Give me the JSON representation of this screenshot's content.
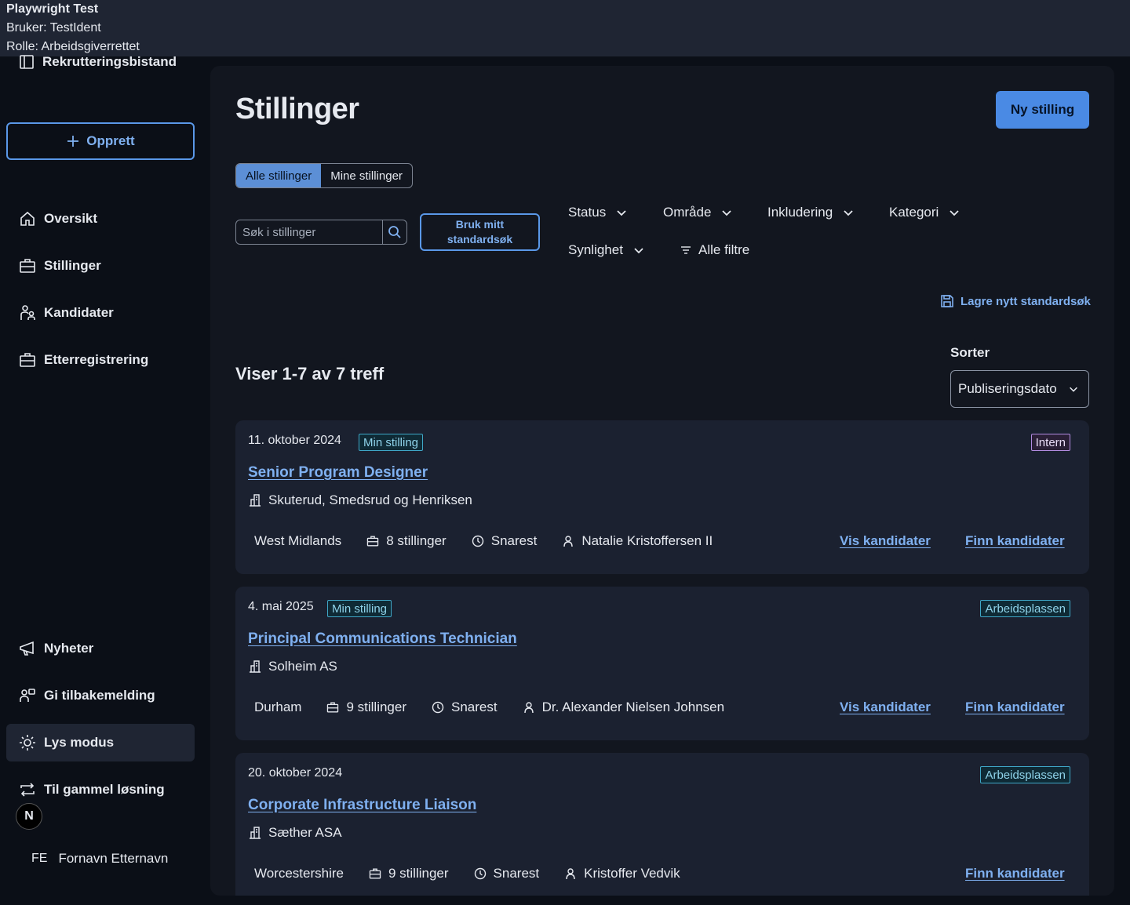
{
  "topbar": {
    "title": "Playwright Test",
    "user": "Bruker: TestIdent",
    "role": "Rolle: Arbeidsgiverrettet"
  },
  "sidebar": {
    "brand": "Rekrutteringsbistand",
    "create_label": "Opprett",
    "nav": [
      {
        "label": "Oversikt",
        "icon": "home-icon"
      },
      {
        "label": "Stillinger",
        "icon": "briefcase-icon"
      },
      {
        "label": "Kandidater",
        "icon": "people-icon"
      },
      {
        "label": "Etterregistrering",
        "icon": "briefcase-icon"
      }
    ],
    "bottom": [
      {
        "label": "Nyheter",
        "icon": "megaphone-icon"
      },
      {
        "label": "Gi tilbakemelding",
        "icon": "feedback-icon"
      },
      {
        "label": "Lys modus",
        "icon": "sun-icon"
      },
      {
        "label": "Til gammel løsning",
        "icon": "arrows-icon"
      }
    ],
    "badge": "N",
    "user_initials": "FE",
    "user_name": "Fornavn Etternavn"
  },
  "main": {
    "title": "Stillinger",
    "new_button": "Ny stilling",
    "toggle": {
      "all": "Alle stillinger",
      "mine": "Mine stillinger",
      "selected": "Alle stillinger"
    },
    "search_placeholder": "Søk i stillinger",
    "std_search_line1": "Bruk mitt",
    "std_search_line2": "standardsøk",
    "filters": [
      "Status",
      "Område",
      "Inkludering",
      "Kategori",
      "Synlighet"
    ],
    "all_filters": "Alle filtre",
    "save_std": "Lagre nytt standardsøk",
    "result_count": "Viser 1-7 av 7 treff",
    "sort_label": "Sorter",
    "sort_value": "Publiseringsdato"
  },
  "jobs": [
    {
      "date": "11. oktober 2024",
      "mine_tag": "Min stilling",
      "source_tag": "Intern",
      "title": "Senior Program Designer",
      "employer": "Skuterud, Smedsrud og Henriksen",
      "location": "West Midlands",
      "positions": "8 stillinger",
      "deadline": "Snarest",
      "owner": "Natalie Kristoffersen II",
      "show": "Vis kandidater",
      "find": "Finn kandidater"
    },
    {
      "date": "4. mai 2025",
      "mine_tag": "Min stilling",
      "source_tag": "Arbeidsplassen",
      "title": "Principal Communications Technician",
      "employer": "Solheim AS",
      "location": "Durham",
      "positions": "9 stillinger",
      "deadline": "Snarest",
      "owner": "Dr. Alexander Nielsen Johnsen",
      "show": "Vis kandidater",
      "find": "Finn kandidater"
    },
    {
      "date": "20. oktober 2024",
      "source_tag": "Arbeidsplassen",
      "title": "Corporate Infrastructure Liaison",
      "employer": "Sæther ASA",
      "location": "Worcestershire",
      "positions": "9 stillinger",
      "deadline": "Snarest",
      "owner": "Kristoffer Vedvik",
      "find": "Finn kandidater"
    }
  ]
}
